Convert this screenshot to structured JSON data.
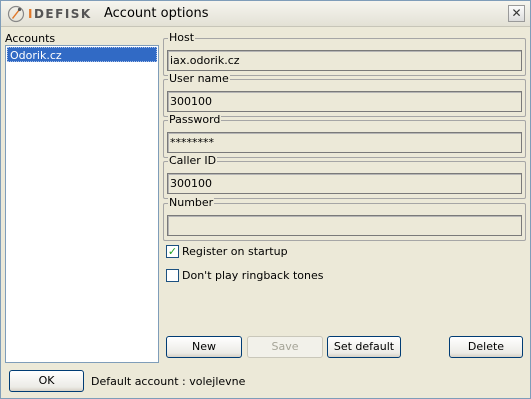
{
  "window": {
    "logo_text_prefix": "I",
    "logo_text_rest": "DEFISK",
    "title": "Account options",
    "close_glyph": "✕"
  },
  "accounts": {
    "label": "Accounts",
    "items": [
      "Odorik.cz"
    ]
  },
  "form": {
    "host": {
      "label": "Host",
      "value": "iax.odorik.cz"
    },
    "username": {
      "label": "User name",
      "value": "300100"
    },
    "password": {
      "label": "Password",
      "value": "********"
    },
    "callerid": {
      "label": "Caller ID",
      "value": "300100"
    },
    "number": {
      "label": "Number",
      "value": ""
    }
  },
  "options": {
    "register_label": "Register on startup",
    "register_checked": true,
    "ringback_label": "Don't play ringback tones",
    "ringback_checked": false
  },
  "buttons": {
    "new": "New",
    "save": "Save",
    "set_default": "Set default",
    "delete": "Delete",
    "ok": "OK"
  },
  "footer": {
    "default_account": "Default account : volejlevne"
  },
  "colors": {
    "selection": "#316ac5",
    "logo_accent": "#e0782a"
  }
}
